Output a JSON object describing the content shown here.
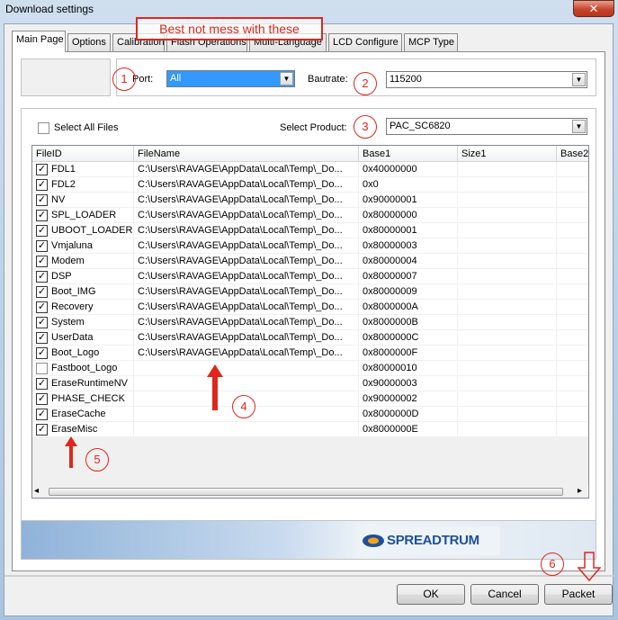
{
  "window": {
    "title": "Download settings",
    "close_glyph": "✕"
  },
  "annotation": {
    "note": "Best not mess with these"
  },
  "tabs": [
    {
      "label": "Main Page"
    },
    {
      "label": "Options"
    },
    {
      "label": "Calibration"
    },
    {
      "label": "Flash Operations"
    },
    {
      "label": "Multi-Language"
    },
    {
      "label": "LCD Configure"
    },
    {
      "label": "MCP Type"
    }
  ],
  "port": {
    "label": "Port:",
    "value": "All"
  },
  "baudrate": {
    "label": "Bautrate:",
    "value": "115200"
  },
  "select_all": {
    "label": "Select All Files",
    "checked": false
  },
  "product": {
    "label": "Select Product:",
    "value": "PAC_SC6820"
  },
  "table": {
    "columns": [
      "FileID",
      "FileName",
      "Base1",
      "Size1",
      "Base2"
    ],
    "rows": [
      {
        "id": "FDL1",
        "file": "C:\\Users\\RAVAGE\\AppData\\Local\\Temp\\_Do...",
        "base": "0x40000000",
        "checked": true
      },
      {
        "id": "FDL2",
        "file": "C:\\Users\\RAVAGE\\AppData\\Local\\Temp\\_Do...",
        "base": "0x0",
        "checked": true
      },
      {
        "id": "NV",
        "file": "C:\\Users\\RAVAGE\\AppData\\Local\\Temp\\_Do...",
        "base": "0x90000001",
        "checked": true
      },
      {
        "id": "SPL_LOADER",
        "file": "C:\\Users\\RAVAGE\\AppData\\Local\\Temp\\_Do...",
        "base": "0x80000000",
        "checked": true
      },
      {
        "id": "UBOOT_LOADER",
        "file": "C:\\Users\\RAVAGE\\AppData\\Local\\Temp\\_Do...",
        "base": "0x80000001",
        "checked": true
      },
      {
        "id": "Vmjaluna",
        "file": "C:\\Users\\RAVAGE\\AppData\\Local\\Temp\\_Do...",
        "base": "0x80000003",
        "checked": true
      },
      {
        "id": "Modem",
        "file": "C:\\Users\\RAVAGE\\AppData\\Local\\Temp\\_Do...",
        "base": "0x80000004",
        "checked": true
      },
      {
        "id": "DSP",
        "file": "C:\\Users\\RAVAGE\\AppData\\Local\\Temp\\_Do...",
        "base": "0x80000007",
        "checked": true
      },
      {
        "id": "Boot_IMG",
        "file": "C:\\Users\\RAVAGE\\AppData\\Local\\Temp\\_Do...",
        "base": "0x80000009",
        "checked": true
      },
      {
        "id": "Recovery",
        "file": "C:\\Users\\RAVAGE\\AppData\\Local\\Temp\\_Do...",
        "base": "0x8000000A",
        "checked": true
      },
      {
        "id": "System",
        "file": "C:\\Users\\RAVAGE\\AppData\\Local\\Temp\\_Do...",
        "base": "0x8000000B",
        "checked": true
      },
      {
        "id": "UserData",
        "file": "C:\\Users\\RAVAGE\\AppData\\Local\\Temp\\_Do...",
        "base": "0x8000000C",
        "checked": true
      },
      {
        "id": "Boot_Logo",
        "file": "C:\\Users\\RAVAGE\\AppData\\Local\\Temp\\_Do...",
        "base": "0x8000000F",
        "checked": true
      },
      {
        "id": "Fastboot_Logo",
        "file": "",
        "base": "0x80000010",
        "checked": false
      },
      {
        "id": "EraseRuntimeNV",
        "file": "",
        "base": "0x90000003",
        "checked": true
      },
      {
        "id": "PHASE_CHECK",
        "file": "",
        "base": "0x90000002",
        "checked": true
      },
      {
        "id": "EraseCache",
        "file": "",
        "base": "0x8000000D",
        "checked": true
      },
      {
        "id": "EraseMisc",
        "file": "",
        "base": "0x8000000E",
        "checked": true
      }
    ]
  },
  "scroll": {
    "left_glyph": "◂",
    "right_glyph": "▸"
  },
  "banner": {
    "brand": "SPREADTRUM"
  },
  "buttons": {
    "ok": "OK",
    "cancel": "Cancel",
    "packet": "Packet"
  },
  "markers": [
    "1",
    "2",
    "3",
    "4",
    "5",
    "6"
  ],
  "colors": {
    "annotation_red": "#e0261c",
    "selection_blue": "#3399ff",
    "brand_blue": "#1d4f9c"
  }
}
